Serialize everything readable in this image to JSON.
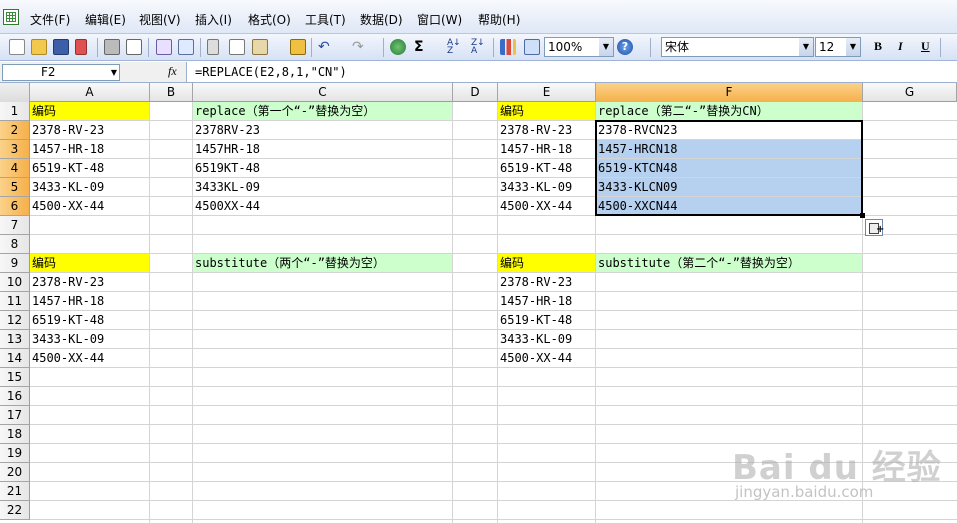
{
  "menu": [
    "文件(F)",
    "编辑(E)",
    "视图(V)",
    "插入(I)",
    "格式(O)",
    "工具(T)",
    "数据(D)",
    "窗口(W)",
    "帮助(H)"
  ],
  "toolbar": {
    "zoom": "100%",
    "font": "宋体",
    "font_size": "12",
    "bold": "B",
    "italic": "I",
    "underline": "U",
    "sum": "Σ"
  },
  "formula_bar": {
    "name_box": "F2",
    "fx": "fx",
    "formula": "=REPLACE(E2,8,1,\"CN\")"
  },
  "columns": [
    "A",
    "B",
    "C",
    "D",
    "E",
    "F",
    "G"
  ],
  "rows": [
    "1",
    "2",
    "3",
    "4",
    "5",
    "6",
    "7",
    "8",
    "9",
    "10",
    "11",
    "12",
    "13",
    "14",
    "15",
    "16",
    "17",
    "18",
    "19",
    "20",
    "21",
    "22"
  ],
  "selected_cell": {
    "column": "F",
    "row": "2"
  },
  "cells": {
    "A1": "编码",
    "C1": "replace（第一个“-”替换为空）",
    "E1": "编码",
    "F1": "replace（第二“-”替换为CN）",
    "A2": "2378-RV-23",
    "C2": "2378RV-23",
    "E2": "2378-RV-23",
    "F2": "2378-RVCN23",
    "A3": "1457-HR-18",
    "C3": "1457HR-18",
    "E3": "1457-HR-18",
    "F3": "1457-HRCN18",
    "A4": "6519-KT-48",
    "C4": "6519KT-48",
    "E4": "6519-KT-48",
    "F4": "6519-KTCN48",
    "A5": "3433-KL-09",
    "C5": "3433KL-09",
    "E5": "3433-KL-09",
    "F5": "3433-KLCN09",
    "A6": "4500-XX-44",
    "C6": "4500XX-44",
    "E6": "4500-XX-44",
    "F6": "4500-XXCN44",
    "A9": "编码",
    "C9": "substitute（两个“-”替换为空）",
    "E9": "编码",
    "F9": "substitute（第二个“-”替换为空）",
    "A10": "2378-RV-23",
    "E10": "2378-RV-23",
    "A11": "1457-HR-18",
    "E11": "1457-HR-18",
    "A12": "6519-KT-48",
    "E12": "6519-KT-48",
    "A13": "3433-KL-09",
    "E13": "3433-KL-09",
    "A14": "4500-XX-44",
    "E14": "4500-XX-44"
  },
  "watermark": {
    "logo": "Bai du 经验",
    "url": "jingyan.baidu.com"
  },
  "colors": {
    "header_yellow": "#ffff00",
    "header_green": "#ccffcc",
    "selection_blue": "#b6d0ef",
    "selected_header": "#f5b04a"
  }
}
